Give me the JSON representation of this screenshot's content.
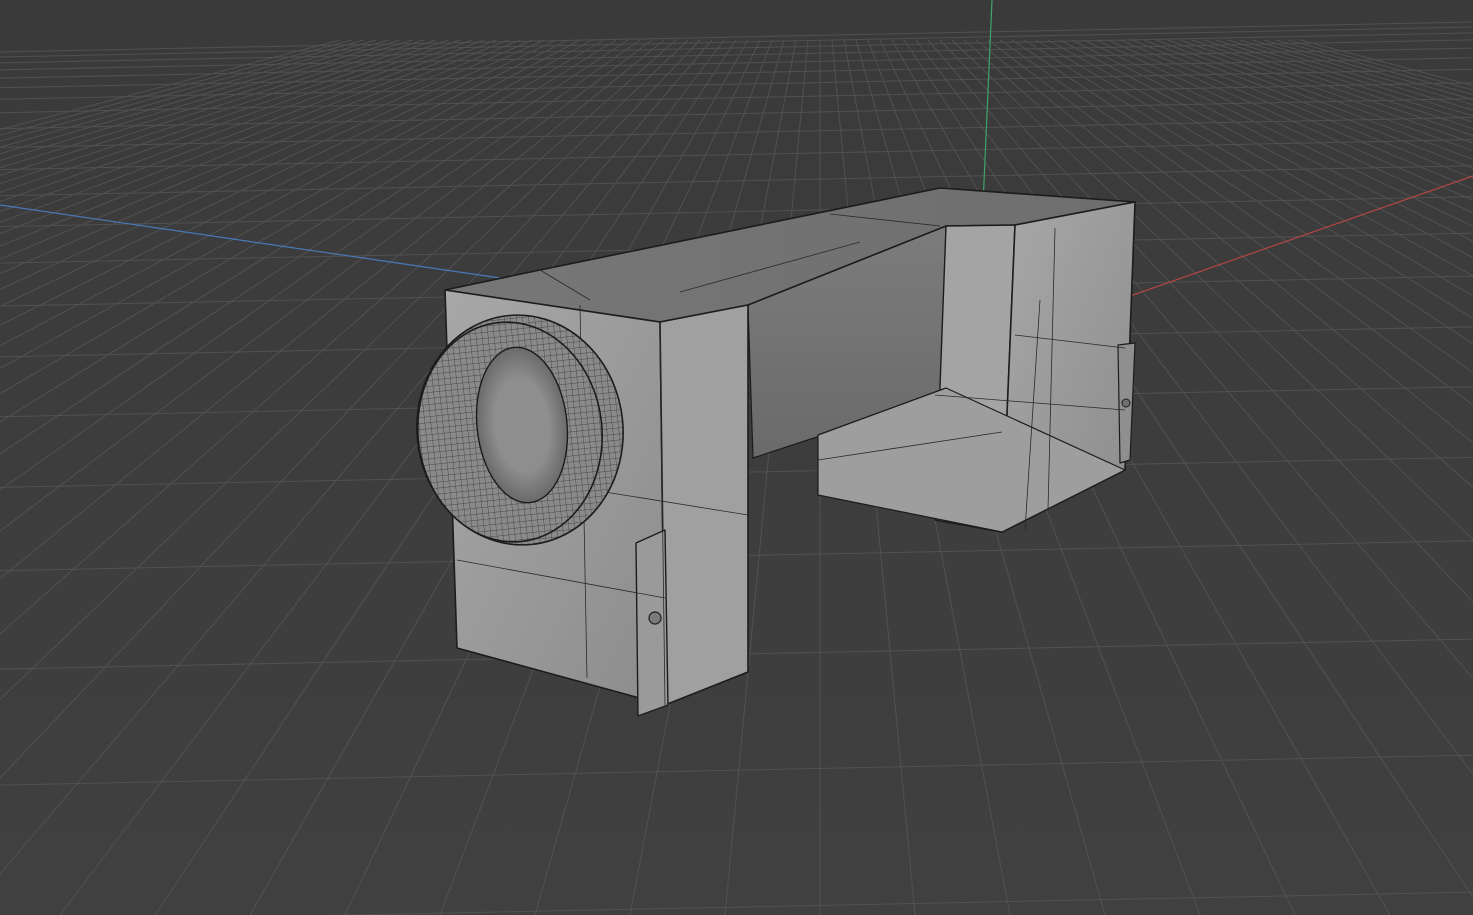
{
  "viewport": {
    "kind": "3d-modeling-viewport",
    "shading": "solid-with-wireframe",
    "background_color": "#3d3d3d",
    "grid_color": "#555555",
    "axis_colors": {
      "x": "#b54646",
      "y": "#3fa36b",
      "z": "#4a78b8"
    },
    "model": {
      "description_visible": false,
      "surface_color": "#9b9b9b",
      "edge_color": "#1c1c1c",
      "wire_color": "#2a2a2a"
    }
  }
}
